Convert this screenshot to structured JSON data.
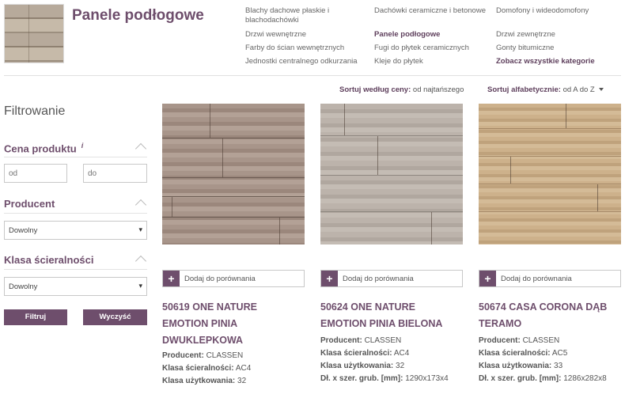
{
  "header": {
    "title": "Panele podłogowe",
    "categories": [
      [
        "Blachy dachowe płaskie i blachodachówki",
        "Drzwi wewnętrzne",
        "Farby do ścian wewnętrznych",
        "Jednostki centralnego odkurzania"
      ],
      [
        "Dachówki ceramiczne i betonowe",
        "Panele podłogowe",
        "Fugi do płytek ceramicznych",
        "Kleje do płytek"
      ],
      [
        "Domofony i wideodomofony",
        "Drzwi zewnętrzne",
        "Gonty bitumiczne",
        "Zobacz wszystkie kategorie"
      ]
    ],
    "cat_a1": "Blachy dachowe płaskie i",
    "cat_a1b": "blachodachówki",
    "cat_a2": "Drzwi wewnętrzne",
    "cat_a3": "Farby do ścian wewnętrznych",
    "cat_a4": "Jednostki centralnego odkurzania",
    "cat_b1": "Dachówki ceramiczne i betonowe",
    "cat_b2": "Panele podłogowe",
    "cat_b3": "Fugi do płytek ceramicznych",
    "cat_b4": "Kleje do płytek",
    "cat_c1": "Domofony i wideodomofony",
    "cat_c2": "Drzwi zewnętrzne",
    "cat_c3": "Gonty bitumiczne",
    "cat_c4": "Zobacz wszystkie kategorie"
  },
  "sort": {
    "price_label": "Sortuj według ceny:",
    "price_value": "od najtańszego",
    "alpha_label": "Sortuj alfabetycznie:",
    "alpha_value": "od A do Z"
  },
  "filters": {
    "title": "Filtrowanie",
    "price": {
      "label": "Cena produktu",
      "info": "i",
      "from_placeholder": "od",
      "to_placeholder": "do"
    },
    "producer": {
      "label": "Producent",
      "selected": "Dowolny"
    },
    "abrasion": {
      "label": "Klasa ścieralności",
      "selected": "Dowolny"
    },
    "filter_button": "Filtruj",
    "clear_button": "Wyczyść"
  },
  "compare_label": "Dodaj do porównania",
  "compare_plus": "+",
  "products": [
    {
      "name": "50619 ONE NATURE EMOTION PINIA DWUKLEPKOWA",
      "producer_label": "Producent:",
      "producer": "CLASSEN",
      "abrasion_label": "Klasa ścieralności:",
      "abrasion": "AC4",
      "usage_label": "Klasa użytkowania:",
      "usage": "32"
    },
    {
      "name": "50624 ONE NATURE EMOTION PINIA BIELONA",
      "producer_label": "Producent:",
      "producer": "CLASSEN",
      "abrasion_label": "Klasa ścieralności:",
      "abrasion": "AC4",
      "usage_label": "Klasa użytkowania:",
      "usage": "32",
      "dims_label": "Dł. x szer. grub. [mm]:",
      "dims": "1290x173x4"
    },
    {
      "name": "50674 CASA CORONA DĄB TERAMO",
      "producer_label": "Producent:",
      "producer": "CLASSEN",
      "abrasion_label": "Klasa ścieralności:",
      "abrasion": "AC5",
      "usage_label": "Klasa użytkowania:",
      "usage": "33",
      "dims_label": "Dł. x szer. grub. [mm]:",
      "dims": "1286x282x8"
    }
  ]
}
